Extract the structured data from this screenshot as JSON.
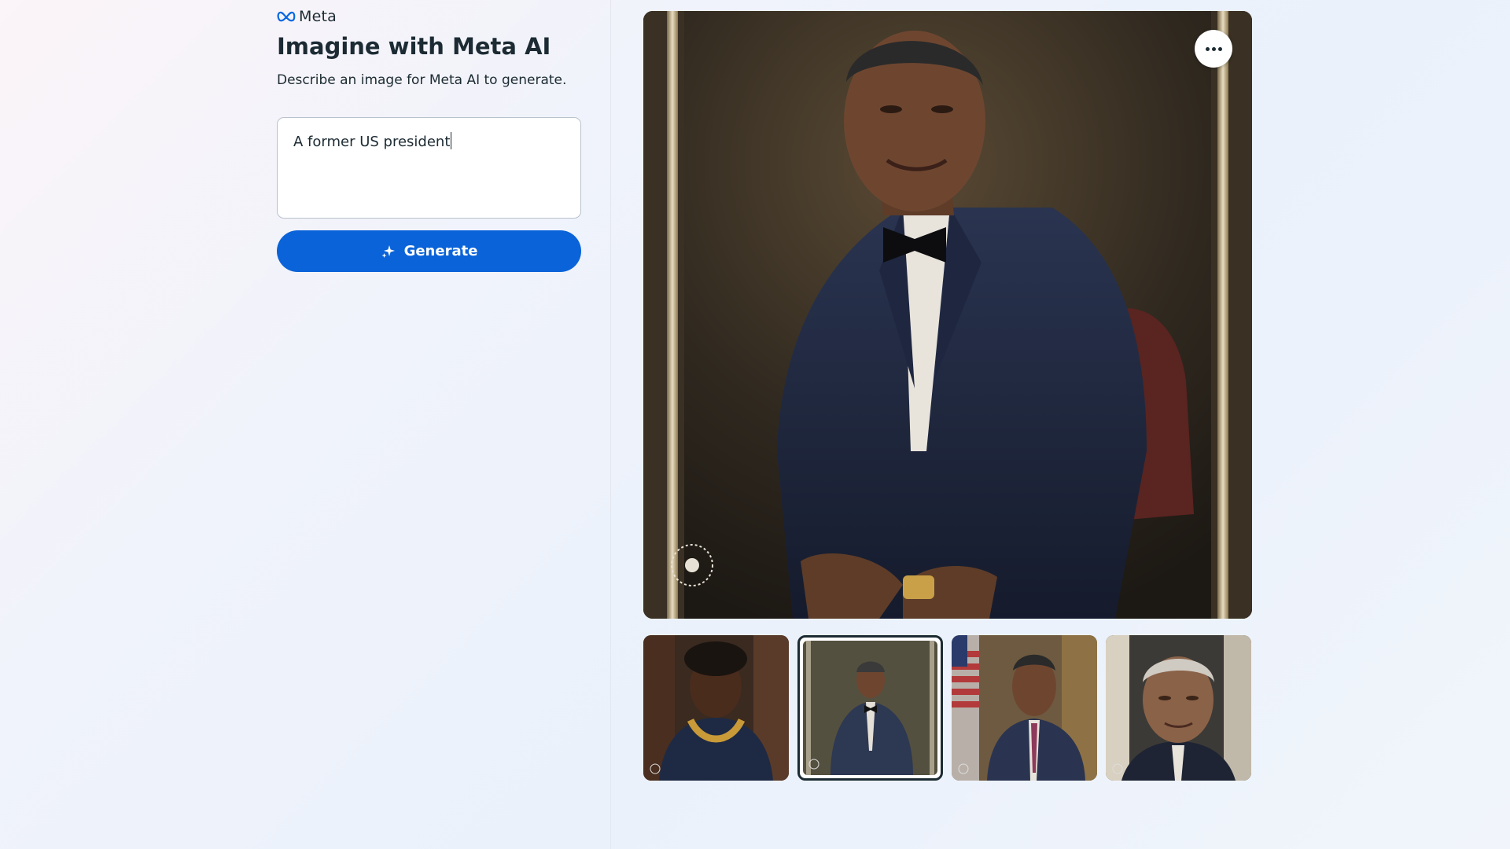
{
  "brand": {
    "name": "Meta",
    "logo_icon": "meta-infinity-logo",
    "logo_color": "#0668e1"
  },
  "header": {
    "title": "Imagine with Meta AI",
    "subtitle": "Describe an image for Meta AI to generate."
  },
  "prompt": {
    "value": "A former US president"
  },
  "generate_button": {
    "label": "Generate",
    "icon": "sparkle-icon",
    "color": "#0a63d8"
  },
  "main_image": {
    "alt": "Generated portrait",
    "more_icon": "more-horizontal-icon"
  },
  "thumbnails": [
    {
      "selected": false
    },
    {
      "selected": true
    },
    {
      "selected": false
    },
    {
      "selected": false
    }
  ]
}
